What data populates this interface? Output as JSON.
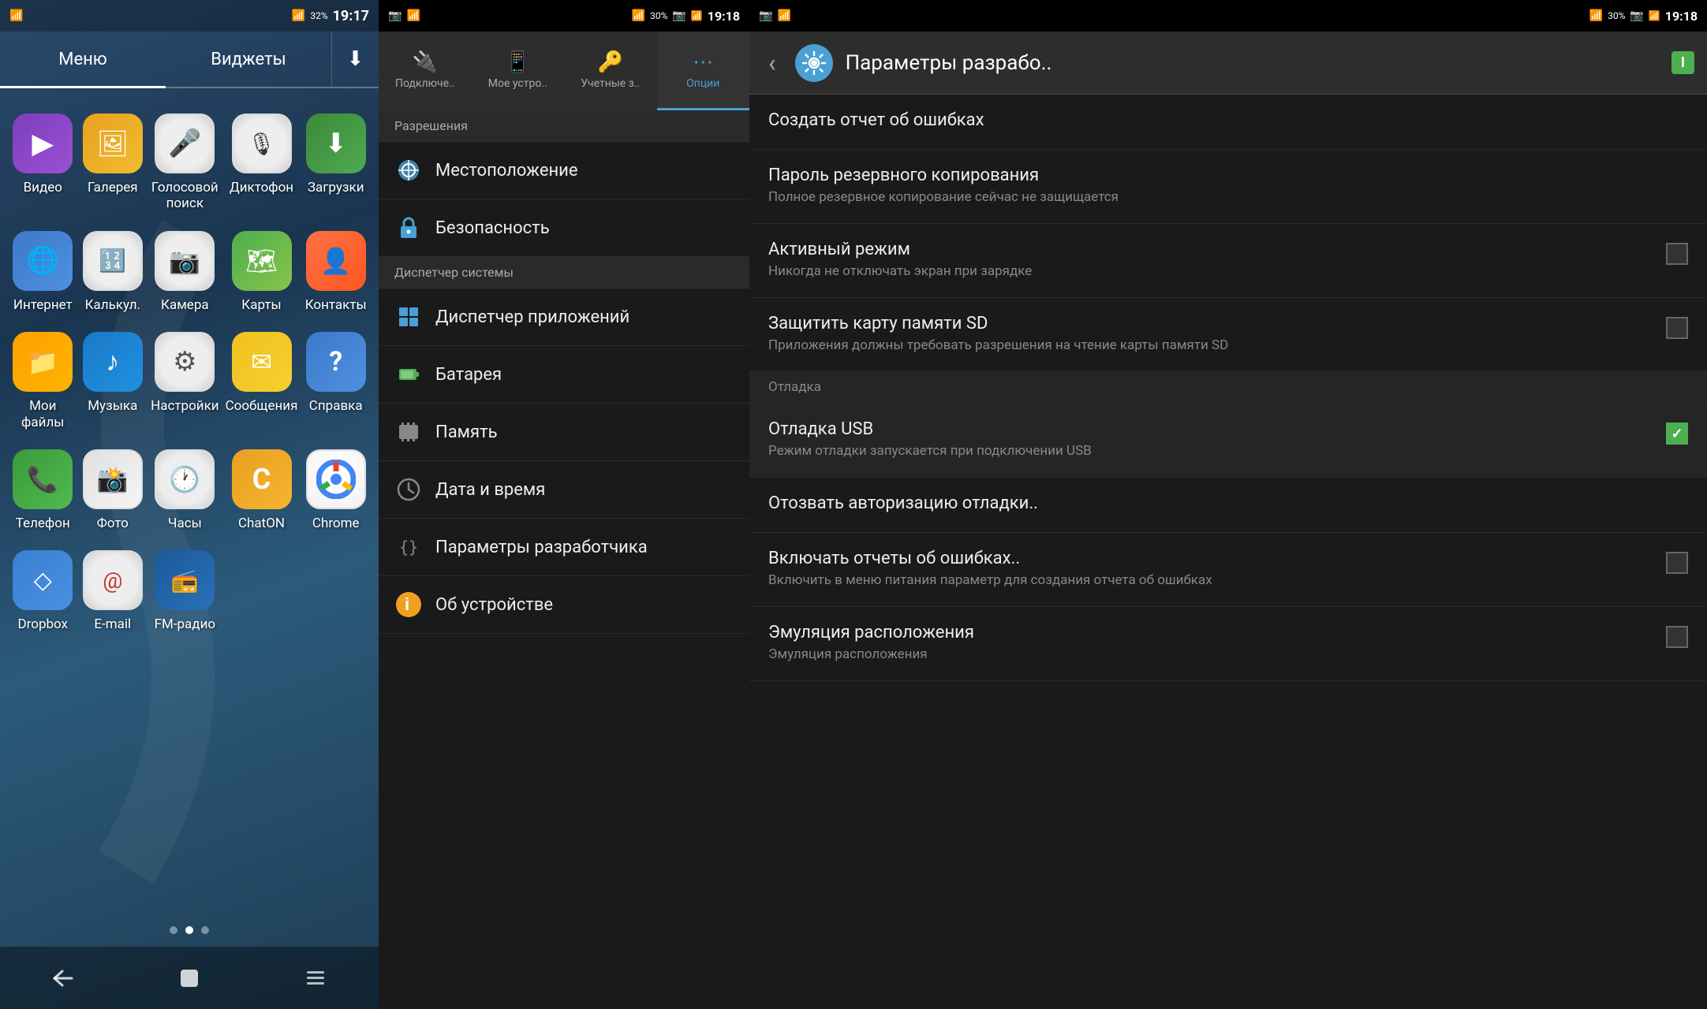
{
  "panel1": {
    "status": {
      "wifi": "WiFi",
      "signal": "32%",
      "time": "19:17"
    },
    "tabs": [
      {
        "label": "Меню",
        "active": true
      },
      {
        "label": "Виджеты",
        "active": false
      },
      {
        "label": "⬇",
        "active": false
      }
    ],
    "apps": [
      {
        "id": "video",
        "label": "Видео",
        "icon": "▶",
        "iconClass": "icon-video"
      },
      {
        "id": "gallery",
        "label": "Галерея",
        "icon": "🖼",
        "iconClass": "icon-gallery"
      },
      {
        "id": "voice",
        "label": "Голосовой\nпоиск",
        "icon": "🎤",
        "iconClass": "icon-voice"
      },
      {
        "id": "dictaphone",
        "label": "Диктофон",
        "icon": "🎙",
        "iconClass": "icon-dictaphone"
      },
      {
        "id": "download",
        "label": "Загрузки",
        "icon": "⬇",
        "iconClass": "icon-download"
      },
      {
        "id": "internet",
        "label": "Интернет",
        "icon": "🌐",
        "iconClass": "icon-internet"
      },
      {
        "id": "calc",
        "label": "Калькул.",
        "icon": "🔢",
        "iconClass": "icon-calc"
      },
      {
        "id": "camera",
        "label": "Камера",
        "icon": "📷",
        "iconClass": "icon-camera"
      },
      {
        "id": "maps",
        "label": "Карты",
        "icon": "🗺",
        "iconClass": "icon-maps"
      },
      {
        "id": "contacts",
        "label": "Контакты",
        "icon": "👤",
        "iconClass": "icon-contacts"
      },
      {
        "id": "myfiles",
        "label": "Мои файлы",
        "icon": "📁",
        "iconClass": "icon-myfiles"
      },
      {
        "id": "music",
        "label": "Музыка",
        "icon": "♪",
        "iconClass": "icon-music"
      },
      {
        "id": "settings",
        "label": "Настройки",
        "icon": "⚙",
        "iconClass": "icon-settings"
      },
      {
        "id": "messages",
        "label": "Сообщения",
        "icon": "✉",
        "iconClass": "icon-messages"
      },
      {
        "id": "help",
        "label": "Справка",
        "icon": "?",
        "iconClass": "icon-help"
      },
      {
        "id": "phone",
        "label": "Телефон",
        "icon": "📞",
        "iconClass": "icon-phone"
      },
      {
        "id": "photos",
        "label": "Фото",
        "icon": "📸",
        "iconClass": "icon-photos"
      },
      {
        "id": "clock",
        "label": "Часы",
        "icon": "🕐",
        "iconClass": "icon-clock"
      },
      {
        "id": "chaton",
        "label": "ChatON",
        "icon": "C",
        "iconClass": "icon-chaton"
      },
      {
        "id": "chrome",
        "label": "Chrome",
        "icon": "◎",
        "iconClass": "icon-chrome"
      },
      {
        "id": "dropbox",
        "label": "Dropbox",
        "icon": "◇",
        "iconClass": "icon-dropbox"
      },
      {
        "id": "email",
        "label": "E-mail",
        "icon": "@",
        "iconClass": "icon-email"
      },
      {
        "id": "fmradio",
        "label": "FM-радио",
        "icon": "📻",
        "iconClass": "icon-fmradio"
      }
    ]
  },
  "panel2": {
    "status": {
      "time": "19:18",
      "battery": "30%"
    },
    "tabs": [
      {
        "id": "connect",
        "label": "Подключе..",
        "icon": "🔌",
        "active": false
      },
      {
        "id": "device",
        "label": "Мое устро..",
        "icon": "📱",
        "active": false
      },
      {
        "id": "accounts",
        "label": "Учетные з..",
        "icon": "🔑",
        "active": false
      },
      {
        "id": "options",
        "label": "Опции",
        "icon": "⋯",
        "active": true
      }
    ],
    "section_header": "Разрешения",
    "items": [
      {
        "id": "location",
        "label": "Местоположение",
        "icon": "🌐",
        "iconColor": "#4a9fd4"
      },
      {
        "id": "security",
        "label": "Безопасность",
        "icon": "🔒",
        "iconColor": "#4a9fd4"
      },
      {
        "id": "sysmanager",
        "label": "Диспетчер системы",
        "icon": null,
        "isHeader": true
      },
      {
        "id": "appmanager",
        "label": "Диспетчер приложений",
        "icon": "⊞",
        "iconColor": "#4a9fd4"
      },
      {
        "id": "battery",
        "label": "Батарея",
        "icon": "🔋",
        "iconColor": "#4CAF50"
      },
      {
        "id": "memory",
        "label": "Память",
        "icon": "💾",
        "iconColor": "#888"
      },
      {
        "id": "datetime",
        "label": "Дата и время",
        "icon": "🕐",
        "iconColor": "#888"
      },
      {
        "id": "devparams",
        "label": "Параметры разработчика",
        "icon": "{}",
        "iconColor": "#888"
      },
      {
        "id": "about",
        "label": "Об устройстве",
        "icon": "ℹ",
        "iconColor": "#f0a020"
      }
    ]
  },
  "panel3": {
    "status": {
      "time": "19:18",
      "battery": "30%"
    },
    "header": {
      "title": "Параметры разрабо..",
      "back_label": "‹",
      "battery_label": "I"
    },
    "items": [
      {
        "id": "create-report",
        "title": "Создать отчет об ошибках",
        "subtitle": "",
        "type": "plain"
      },
      {
        "id": "backup-password",
        "title": "Пароль резервного копирования",
        "subtitle": "Полное резервное копирование сейчас не защищается",
        "type": "plain"
      },
      {
        "id": "active-mode",
        "title": "Активный режим",
        "subtitle": "Никогда не отключать экран при зарядке",
        "type": "checkbox",
        "checked": false
      },
      {
        "id": "protect-sd",
        "title": "Защитить карту памяти SD",
        "subtitle": "Приложения должны требовать разрешения на чтение карты памяти SD",
        "type": "checkbox",
        "checked": false
      },
      {
        "id": "debug-section",
        "title": "Отладка",
        "type": "section"
      },
      {
        "id": "usb-debug",
        "title": "Отладка USB",
        "subtitle": "Режим отладки запускается при подключении USB",
        "type": "checkbox",
        "checked": true
      },
      {
        "id": "revoke-debug",
        "title": "Отозвать авторизацию отладки..",
        "subtitle": "",
        "type": "plain"
      },
      {
        "id": "error-reports",
        "title": "Включать отчеты об ошибках..",
        "subtitle": "Включить в меню питания параметр для создания отчета об ошибках",
        "type": "checkbox",
        "checked": false
      },
      {
        "id": "emulate-location",
        "title": "Эмуляция расположения",
        "subtitle": "Эмуляция расположения",
        "type": "checkbox",
        "checked": false
      }
    ]
  }
}
